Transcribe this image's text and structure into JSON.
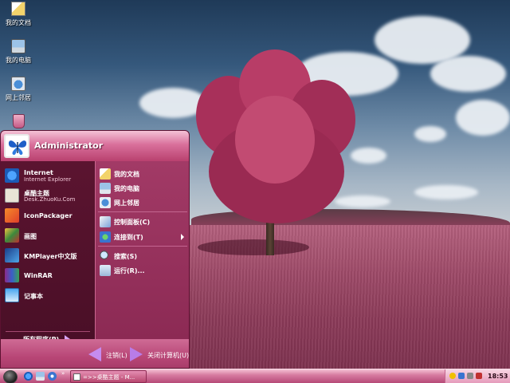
{
  "desktop": {
    "icons": [
      {
        "label": "我的文档",
        "icon": "my-documents-icon"
      },
      {
        "label": "我的电脑",
        "icon": "my-computer-icon"
      },
      {
        "label": "网上邻居",
        "icon": "network-places-icon"
      },
      {
        "label": "",
        "icon": "recycle-bin-icon"
      }
    ]
  },
  "start_menu": {
    "user": "Administrator",
    "pinned": [
      {
        "title": "Internet",
        "subtitle": "Internet Explorer",
        "icon": "internet-explorer-icon"
      },
      {
        "title": "桌酷主题",
        "subtitle": "Desk.ZhuoKu.Com",
        "icon": "zhuoku-icon"
      }
    ],
    "programs": [
      {
        "title": "IconPackager",
        "icon": "iconpackager-icon"
      },
      {
        "title": "画图",
        "icon": "paint-icon"
      },
      {
        "title": "KMPlayer中文版",
        "icon": "kmplayer-icon"
      },
      {
        "title": "WinRAR",
        "icon": "winrar-icon"
      },
      {
        "title": "记事本",
        "icon": "notepad-icon"
      }
    ],
    "all_programs": "所有程序(P)",
    "right": [
      {
        "label": "我的文档",
        "icon": "my-documents-icon"
      },
      {
        "label": "我的电脑",
        "icon": "my-computer-icon"
      },
      {
        "label": "网上邻居",
        "icon": "network-places-icon"
      },
      {
        "label": "控制面板(C)",
        "icon": "control-panel-icon"
      },
      {
        "label": "连接到(T)",
        "icon": "connect-to-icon"
      },
      {
        "label": "搜索(S)",
        "icon": "search-icon"
      },
      {
        "label": "运行(R)...",
        "icon": "run-icon"
      }
    ],
    "logoff": "注销(L)",
    "shutdown": "关闭计算机(U)"
  },
  "taskbar": {
    "quick_launch_more": "»",
    "task_button": "=>>桌酷主题 - M...",
    "clock": "18:53"
  }
}
